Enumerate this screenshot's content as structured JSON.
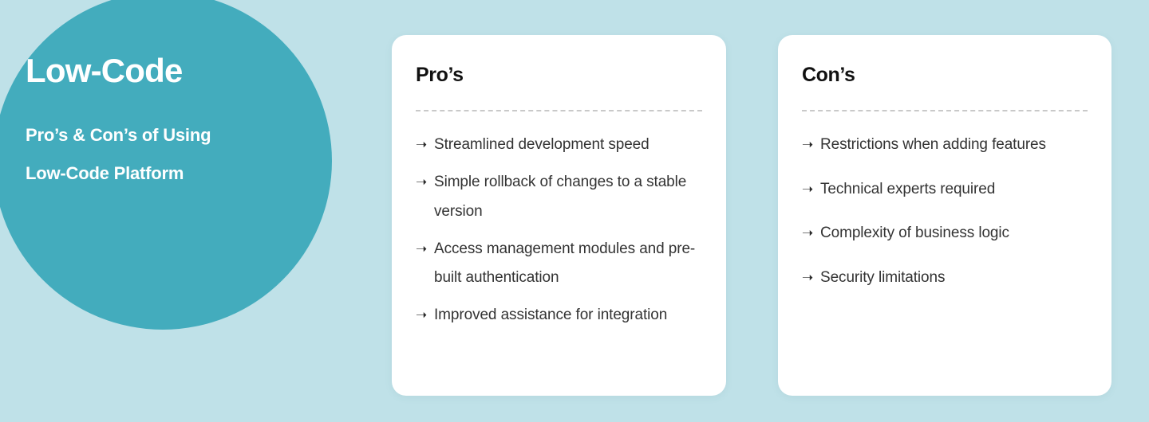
{
  "canvas": {
    "background_color": "#bfe1e8",
    "accent_color": "#43acbd",
    "card_background": "#ffffff",
    "text_color": "#333333",
    "divider_color": "#c9c9c9"
  },
  "hero": {
    "title": "Low-Code",
    "subtitle_line1": "Pro’s & Con’s of Using",
    "subtitle_line2": "Low-Code Platform",
    "circle_icon": "decorative-circle"
  },
  "cards": [
    {
      "id": "pros",
      "title": "Pro’s",
      "bullet_icon": "arrow-right-icon",
      "bullet_glyph": "➝",
      "items": [
        "Streamlined development speed",
        "Simple rollback of changes to a stable version",
        "Access management modules and pre-built authentication",
        "Improved assistance for integration"
      ]
    },
    {
      "id": "cons",
      "title": "Con’s",
      "bullet_icon": "arrow-right-icon",
      "bullet_glyph": "➝",
      "items": [
        "Restrictions when adding features",
        "Technical experts required",
        "Complexity of business logic",
        "Security limitations"
      ]
    }
  ]
}
